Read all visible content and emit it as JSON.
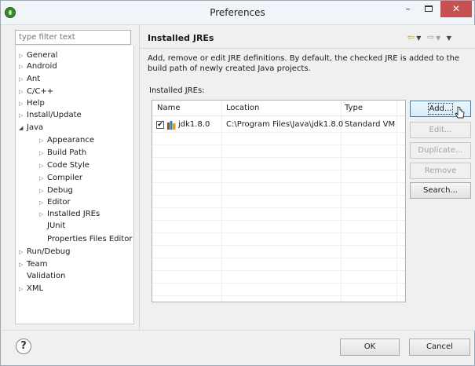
{
  "window": {
    "title": "Preferences",
    "min_glyph": "–",
    "close_glyph": "✕"
  },
  "filter": {
    "placeholder": "type filter text"
  },
  "tree": {
    "items": [
      {
        "label": "General"
      },
      {
        "label": "Android"
      },
      {
        "label": "Ant"
      },
      {
        "label": "C/C++"
      },
      {
        "label": "Help"
      },
      {
        "label": "Install/Update"
      },
      {
        "label": "Java"
      },
      {
        "label": "Appearance"
      },
      {
        "label": "Build Path"
      },
      {
        "label": "Code Style"
      },
      {
        "label": "Compiler"
      },
      {
        "label": "Debug"
      },
      {
        "label": "Editor"
      },
      {
        "label": "Installed JREs"
      },
      {
        "label": "JUnit"
      },
      {
        "label": "Properties Files Editor"
      },
      {
        "label": "Run/Debug"
      },
      {
        "label": "Team"
      },
      {
        "label": "Validation"
      },
      {
        "label": "XML"
      }
    ]
  },
  "page": {
    "title": "Installed JREs",
    "description": "Add, remove or edit JRE definitions. By default, the checked JRE is added to the build path of newly created Java projects.",
    "jre_label_pre": "Installed ",
    "jre_label_mnemonic": "J",
    "jre_label_post": "REs:"
  },
  "table": {
    "columns": [
      "Name",
      "Location",
      "Type"
    ],
    "rows": [
      {
        "checked": true,
        "name": "jdk1.8.0",
        "location": "C:\\Program Files\\Java\\jdk1.8.0",
        "type": "Standard VM"
      }
    ]
  },
  "buttons": {
    "add": "Add...",
    "edit": "Edit...",
    "duplicate": "Duplicate...",
    "remove": "Remove",
    "search": "Search...",
    "ok": "OK",
    "cancel": "Cancel"
  },
  "icons": {
    "help": "?",
    "check": "✔"
  },
  "colors": {
    "close_button": "#c75050",
    "nav_arrow": "#c79a1d"
  }
}
